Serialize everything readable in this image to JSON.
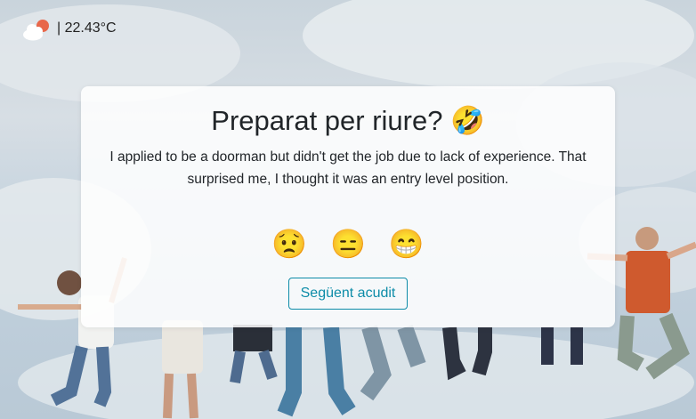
{
  "weather": {
    "icon": "cloud-sun-icon",
    "temperature": "| 22.43°C"
  },
  "card": {
    "title": "Preparat per riure? 🤣",
    "joke": "I applied to be a doorman but didn't get the job due to lack of experience. That surprised me, I thought it was an entry level position.",
    "reactions": [
      "😟",
      "😑",
      "😁"
    ],
    "next_button": "Següent acudit"
  },
  "colors": {
    "accent": "#0d8ca8",
    "sun": "#e8674a"
  }
}
